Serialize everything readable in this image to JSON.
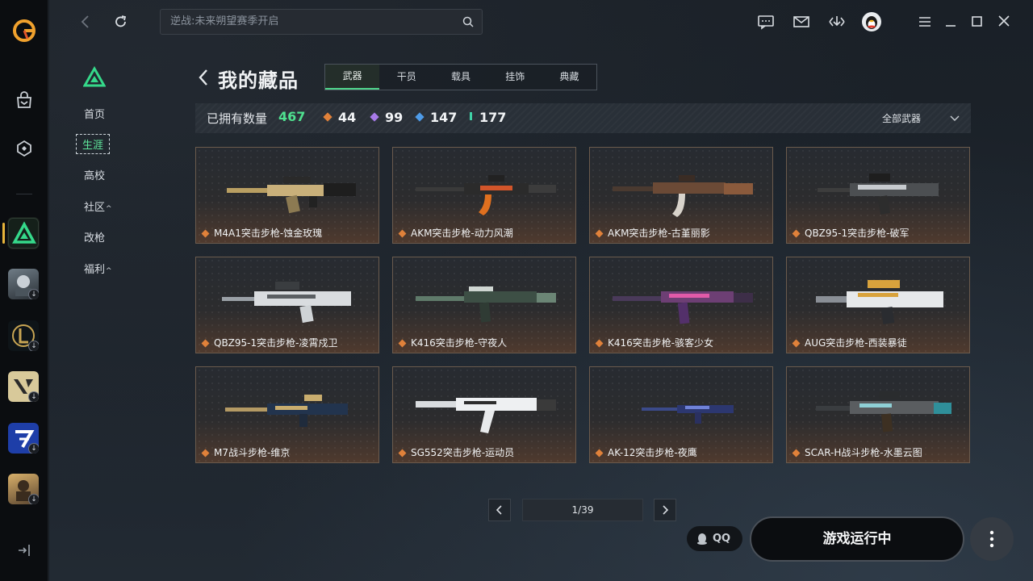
{
  "search": {
    "placeholder": "逆战:未来朔望赛季开启"
  },
  "subnav": {
    "items": [
      {
        "label": "首页"
      },
      {
        "label": "生涯"
      },
      {
        "label": "高校"
      },
      {
        "label": "社区"
      },
      {
        "label": "改枪"
      },
      {
        "label": "福利"
      }
    ],
    "caret": "^"
  },
  "page": {
    "title": "我的藏品"
  },
  "tabs": [
    "武器",
    "干员",
    "载具",
    "挂饰",
    "典藏"
  ],
  "stats": {
    "label": "已拥有数量",
    "total": "467",
    "tiers": [
      {
        "value": "44",
        "color": "#e0813a"
      },
      {
        "value": "99",
        "color": "#a77ae8"
      },
      {
        "value": "147",
        "color": "#4e9be8"
      },
      {
        "value": "177",
        "color": "#3fd2a6"
      }
    ],
    "filter": "全部武器"
  },
  "cards": [
    {
      "name": "M4A1突击步枪-蚀金玫瑰"
    },
    {
      "name": "AKM突击步枪-动力风潮"
    },
    {
      "name": "AKM突击步枪-古堇丽影"
    },
    {
      "name": "QBZ95-1突击步枪-破军"
    },
    {
      "name": "QBZ95-1突击步枪-凌霄戍卫"
    },
    {
      "name": "K416突击步枪-守夜人"
    },
    {
      "name": "K416突击步枪-骇客少女"
    },
    {
      "name": "AUG突击步枪-西装暴徒"
    },
    {
      "name": "M7战斗步枪-维京"
    },
    {
      "name": "SG552突击步枪-运动员"
    },
    {
      "name": "AK-12突击步枪-夜鹰"
    },
    {
      "name": "SCAR-H战斗步枪-水墨云图"
    }
  ],
  "pager": {
    "text": "1/39"
  },
  "qq": {
    "label": "QQ"
  },
  "launch": {
    "label": "游戏运行中"
  },
  "colors": {
    "accent": "#4fe08f",
    "rarity_orange": "#e0813a"
  }
}
